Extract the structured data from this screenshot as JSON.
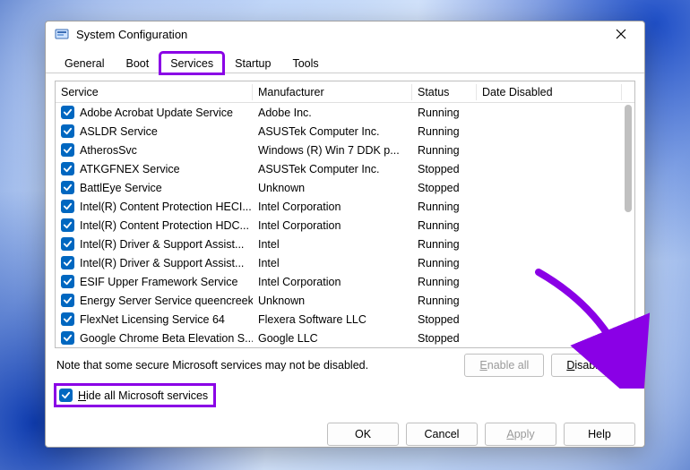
{
  "window": {
    "title": "System Configuration"
  },
  "tabs": [
    {
      "label": "General",
      "active": false
    },
    {
      "label": "Boot",
      "active": false
    },
    {
      "label": "Services",
      "active": true,
      "highlight": true
    },
    {
      "label": "Startup",
      "active": false
    },
    {
      "label": "Tools",
      "active": false
    }
  ],
  "columns": {
    "service": "Service",
    "manufacturer": "Manufacturer",
    "status": "Status",
    "date_disabled": "Date Disabled"
  },
  "services": [
    {
      "name": "Adobe Acrobat Update Service",
      "manufacturer": "Adobe Inc.",
      "status": "Running"
    },
    {
      "name": "ASLDR Service",
      "manufacturer": "ASUSTek Computer Inc.",
      "status": "Running"
    },
    {
      "name": "AtherosSvc",
      "manufacturer": "Windows (R) Win 7 DDK p...",
      "status": "Running"
    },
    {
      "name": "ATKGFNEX Service",
      "manufacturer": "ASUSTek Computer Inc.",
      "status": "Stopped"
    },
    {
      "name": "BattlEye Service",
      "manufacturer": "Unknown",
      "status": "Stopped"
    },
    {
      "name": "Intel(R) Content Protection HECI...",
      "manufacturer": "Intel Corporation",
      "status": "Running"
    },
    {
      "name": "Intel(R) Content Protection HDC...",
      "manufacturer": "Intel Corporation",
      "status": "Running"
    },
    {
      "name": "Intel(R) Driver & Support Assist...",
      "manufacturer": "Intel",
      "status": "Running"
    },
    {
      "name": "Intel(R) Driver & Support Assist...",
      "manufacturer": "Intel",
      "status": "Running"
    },
    {
      "name": "ESIF Upper Framework Service",
      "manufacturer": "Intel Corporation",
      "status": "Running"
    },
    {
      "name": "Energy Server Service queencreek",
      "manufacturer": "Unknown",
      "status": "Running"
    },
    {
      "name": "FlexNet Licensing Service 64",
      "manufacturer": "Flexera Software LLC",
      "status": "Stopped"
    },
    {
      "name": "Google Chrome Beta Elevation S...",
      "manufacturer": "Google LLC",
      "status": "Stopped"
    }
  ],
  "note": "Note that some secure Microsoft services may not be disabled.",
  "buttons": {
    "enable_all": "Enable all",
    "disable_all": "Disable all",
    "ok": "OK",
    "cancel": "Cancel",
    "apply": "Apply",
    "help": "Help"
  },
  "hide_checkbox": {
    "label": "Hide all Microsoft services",
    "checked": true,
    "highlight": true
  },
  "annotations": {
    "arrow_target": "disable-all-button",
    "color": "#8a00e6"
  }
}
